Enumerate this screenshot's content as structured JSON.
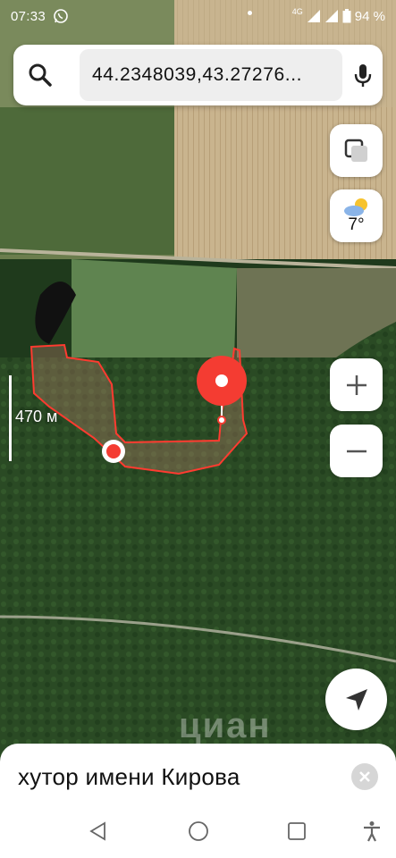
{
  "status_bar": {
    "time": "07:33",
    "network": "4G",
    "battery": "94 %"
  },
  "search": {
    "value": "44.2348039,43.27276..."
  },
  "weather": {
    "temperature": "7°",
    "icon": "partly-cloudy-icon"
  },
  "map": {
    "scale_label": "470 м",
    "watermark": "циан",
    "marker_color": "#f43c32",
    "boundary_color": "#ff3b30"
  },
  "place": {
    "title": "хутор имени Кирова"
  },
  "controls": {
    "layers_icon": "layers-icon",
    "zoom_in_icon": "plus-icon",
    "zoom_out_icon": "minus-icon",
    "locate_icon": "navigation-arrow-icon",
    "close_icon": "close-icon"
  },
  "nav_bar": {
    "back_icon": "back-triangle-icon",
    "home_icon": "home-circle-icon",
    "recents_icon": "recents-square-icon",
    "accessibility_icon": "accessibility-icon"
  }
}
